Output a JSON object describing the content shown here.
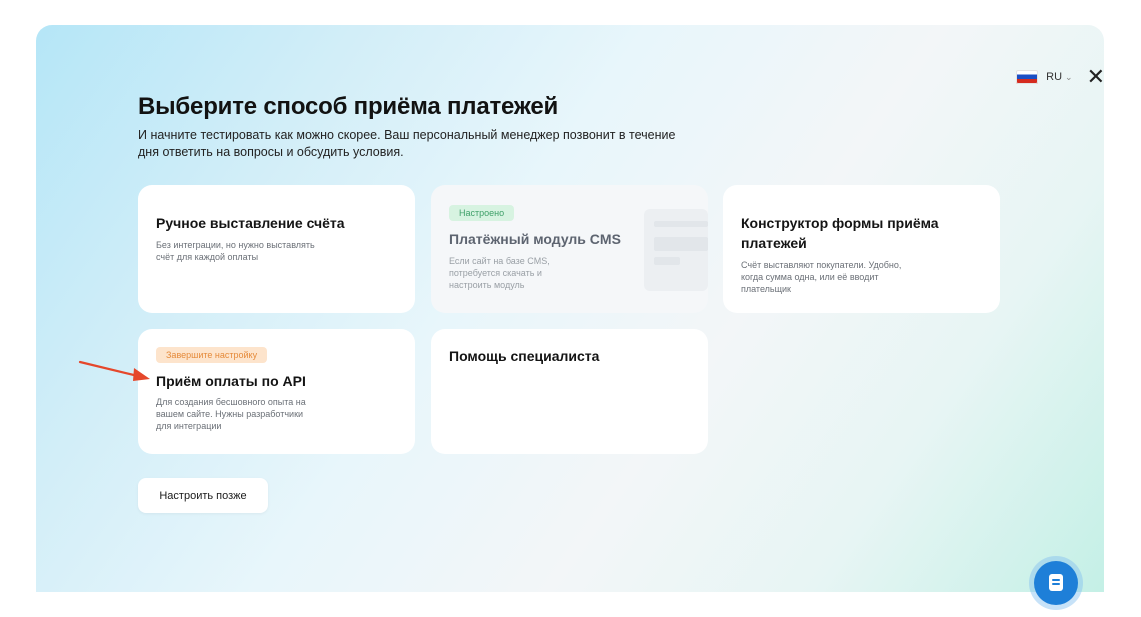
{
  "header": {
    "title": "Выберите способ приёма платежей",
    "subtitle": "И начните тестировать как можно скорее. Ваш персональный менеджер позвонит в течение дня ответить на вопросы и обсудить условия."
  },
  "language": {
    "selected": "RU",
    "flag_icon": "russia-flag-icon"
  },
  "cards": [
    {
      "title": "Ручное выставление счёта",
      "description": "Без интеграции, но нужно выставлять счёт для каждой оплаты",
      "badge": ""
    },
    {
      "title": "Платёжный модуль CMS",
      "description": "Если сайт на базе CMS, потребуется скачать и настроить модуль",
      "badge": "Настроено"
    },
    {
      "title": "Конструктор формы приёма платежей",
      "description": "Счёт выставляют покупатели. Удобно, когда сумма одна, или её вводит плательщик",
      "badge": ""
    },
    {
      "title": "Приём оплаты по API",
      "description": "Для создания бесшовного опыта на вашем сайте. Нужны разработчики для интеграции",
      "badge": "Завершите настройку"
    },
    {
      "title": "Помощь специалиста",
      "description": "",
      "badge": ""
    }
  ],
  "actions": {
    "later_label": "Настроить позже"
  },
  "colors": {
    "accent": "#1e7fd8",
    "badge_green": "#3fa069",
    "badge_orange": "#e58a3a",
    "arrow": "#e5472b"
  }
}
